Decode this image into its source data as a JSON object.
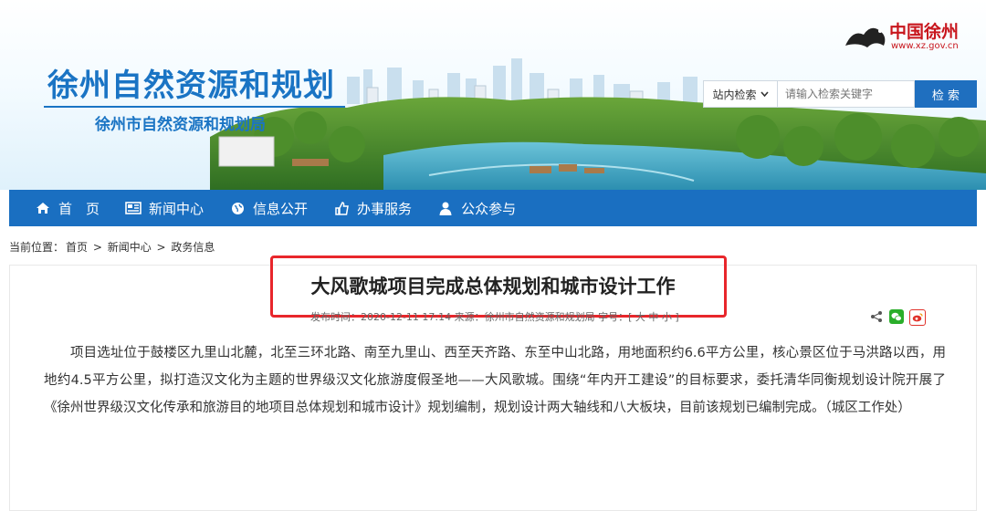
{
  "header": {
    "site_title": "徐州自然资源和规划",
    "site_subtitle": "徐州市自然资源和规划局",
    "logo_text": "中国徐州",
    "logo_url": "www.xz.gov.cn"
  },
  "search": {
    "scope_label": "站内检索",
    "placeholder": "请输入检索关键字",
    "button_label": "检 索"
  },
  "nav": {
    "items": [
      {
        "label": "首　页",
        "icon": "home-icon"
      },
      {
        "label": "新闻中心",
        "icon": "newspaper-icon"
      },
      {
        "label": "信息公开",
        "icon": "globe-icon"
      },
      {
        "label": "办事服务",
        "icon": "thumbs-up-icon"
      },
      {
        "label": "公众参与",
        "icon": "user-icon"
      }
    ]
  },
  "breadcrumb": {
    "prefix": "当前位置：",
    "items": [
      "首页",
      "新闻中心",
      "政务信息"
    ],
    "separator": " > "
  },
  "article": {
    "title": "大风歌城项目完成总体规划和城市设计工作",
    "meta": "发布时间：2020-12-11 17:14   来源：徐州市自然资源和规划局   字号：[ 大 中 小 ]",
    "body": "项目选址位于鼓楼区九里山北麓，北至三环北路、南至九里山、西至天齐路、东至中山北路，用地面积约6.6平方公里，核心景区位于马洪路以西，用地约4.5平方公里，拟打造汉文化为主题的世界级汉文化旅游度假圣地——大风歌城。围绕“年内开工建设”的目标要求，委托清华同衡规划设计院开展了《徐州世界级汉文化传承和旅游目的地项目总体规划和城市设计》规划编制，规划设计两大轴线和八大板块，目前该规划已编制完成。（城区工作处）"
  },
  "colors": {
    "brand_blue": "#1a6fc1",
    "highlight_red": "#e8262b",
    "logo_red": "#c8161d"
  }
}
